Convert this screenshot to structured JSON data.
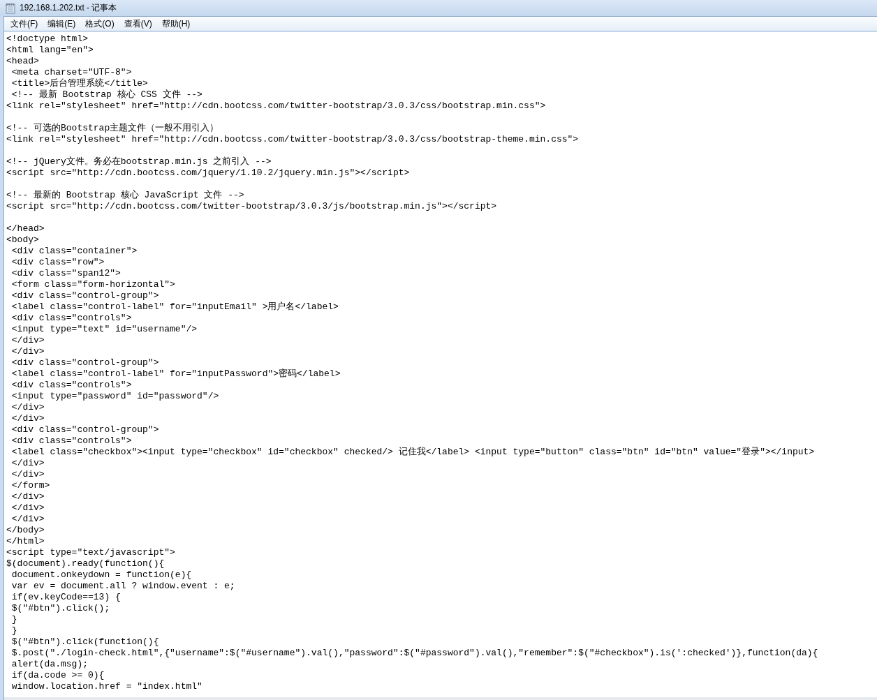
{
  "window": {
    "title": "192.168.1.202.txt - 记事本"
  },
  "menu": [
    {
      "label": "文件(F)"
    },
    {
      "label": "编辑(E)"
    },
    {
      "label": "格式(O)"
    },
    {
      "label": "查看(V)"
    },
    {
      "label": "帮助(H)"
    }
  ],
  "editor": {
    "text": "<!doctype html>\n<html lang=\"en\">\n<head>\n <meta charset=\"UTF-8\">\n <title>后台管理系统</title>\n <!-- 最新 Bootstrap 核心 CSS 文件 -->\n<link rel=\"stylesheet\" href=\"http://cdn.bootcss.com/twitter-bootstrap/3.0.3/css/bootstrap.min.css\">\n\n<!-- 可选的Bootstrap主题文件（一般不用引入）\n<link rel=\"stylesheet\" href=\"http://cdn.bootcss.com/twitter-bootstrap/3.0.3/css/bootstrap-theme.min.css\">\n\n<!-- jQuery文件。务必在bootstrap.min.js 之前引入 -->\n<script src=\"http://cdn.bootcss.com/jquery/1.10.2/jquery.min.js\"></script>\n\n<!-- 最新的 Bootstrap 核心 JavaScript 文件 -->\n<script src=\"http://cdn.bootcss.com/twitter-bootstrap/3.0.3/js/bootstrap.min.js\"></script>\n\n</head>\n<body>\n <div class=\"container\">\n <div class=\"row\">\n <div class=\"span12\">\n <form class=\"form-horizontal\">\n <div class=\"control-group\">\n <label class=\"control-label\" for=\"inputEmail\" >用户名</label>\n <div class=\"controls\">\n <input type=\"text\" id=\"username\"/>\n </div>\n </div>\n <div class=\"control-group\">\n <label class=\"control-label\" for=\"inputPassword\">密码</label>\n <div class=\"controls\">\n <input type=\"password\" id=\"password\"/>\n </div>\n </div>\n <div class=\"control-group\">\n <div class=\"controls\">\n <label class=\"checkbox\"><input type=\"checkbox\" id=\"checkbox\" checked/> 记住我</label> <input type=\"button\" class=\"btn\" id=\"btn\" value=\"登录\"></input>\n </div>\n </div>\n </form>\n </div>\n </div>\n </div>\n</body>\n</html>\n<script type=\"text/javascript\">\n$(document).ready(function(){\n document.onkeydown = function(e){\n var ev = document.all ? window.event : e;\n if(ev.keyCode==13) {\n $(\"#btn\").click();\n }\n }\n $(\"#btn\").click(function(){\n $.post(\"./login-check.html\",{\"username\":$(\"#username\").val(),\"password\":$(\"#password\").val(),\"remember\":$(\"#checkbox\").is(':checked')},function(da){\n alert(da.msg);\n if(da.code >= 0){\n window.location.href = \"index.html\""
  }
}
